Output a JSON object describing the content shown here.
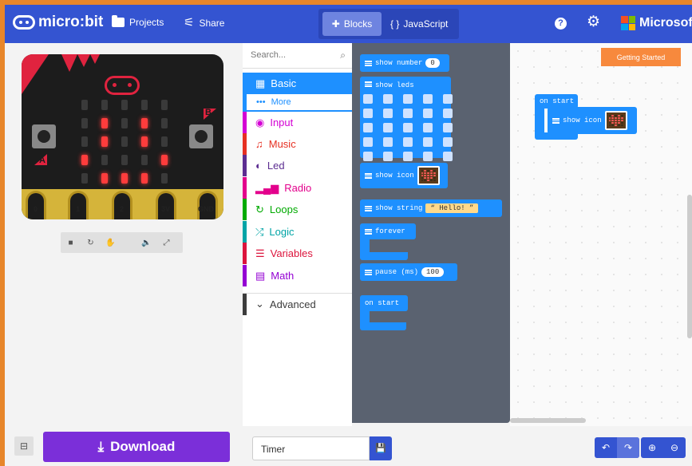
{
  "header": {
    "logo_text": "micro:bit",
    "projects_label": "Projects",
    "share_label": "Share",
    "blocks_label": "Blocks",
    "javascript_label": "JavaScript",
    "javascript_icon": "{ }",
    "help_icon": "?",
    "brand": "Microsoft"
  },
  "simulator": {
    "pins": [
      "0",
      "1",
      "2",
      "3V",
      "GND"
    ],
    "button_a": "A",
    "button_b": "B",
    "leds_on": [
      [
        1,
        1
      ],
      [
        3,
        1
      ],
      [
        1,
        2
      ],
      [
        3,
        2
      ],
      [
        0,
        3
      ],
      [
        4,
        3
      ],
      [
        1,
        4
      ],
      [
        2,
        4
      ],
      [
        3,
        4
      ]
    ]
  },
  "toolbox": {
    "search_placeholder": "Search...",
    "categories": [
      {
        "label": "Basic",
        "color": "#1e90ff"
      },
      {
        "label": "More",
        "color": "#1e90ff"
      },
      {
        "label": "Input",
        "color": "#d400d4"
      },
      {
        "label": "Music",
        "color": "#e63022"
      },
      {
        "label": "Led",
        "color": "#5c2d91"
      },
      {
        "label": "Radio",
        "color": "#e3008c"
      },
      {
        "label": "Loops",
        "color": "#00aa00"
      },
      {
        "label": "Logic",
        "color": "#00a4a6"
      },
      {
        "label": "Variables",
        "color": "#dc143c"
      },
      {
        "label": "Math",
        "color": "#9400d3"
      },
      {
        "label": "Advanced",
        "color": "#3c3c3c"
      }
    ]
  },
  "flyout": {
    "show_number": "show number",
    "show_number_value": "0",
    "show_leds": "show leds",
    "show_icon": "show icon",
    "show_string": "show string",
    "show_string_value": "Hello!",
    "forever": "forever",
    "pause": "pause (ms)",
    "pause_value": "100",
    "on_start": "on start"
  },
  "workspace": {
    "getting_started": "Getting Started",
    "on_start": "on start",
    "show_icon": "show icon"
  },
  "footer": {
    "download_label": "Download",
    "project_name": "Timer"
  }
}
